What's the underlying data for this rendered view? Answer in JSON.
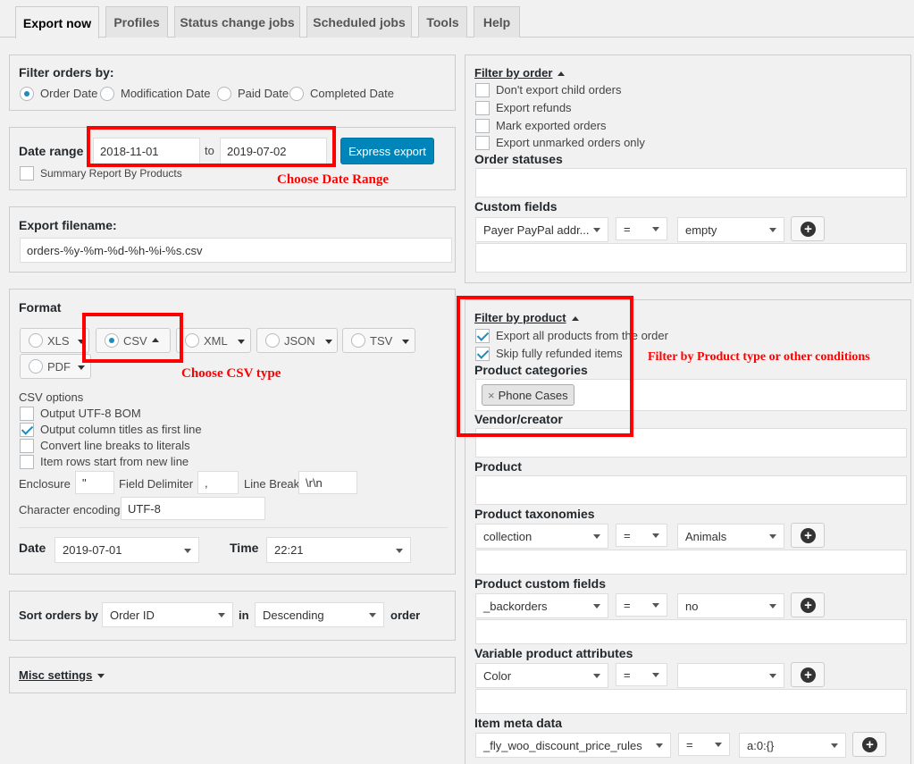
{
  "tabs": [
    "Export now",
    "Profiles",
    "Status change jobs",
    "Scheduled jobs",
    "Tools",
    "Help"
  ],
  "filter_orders": {
    "title": "Filter orders by:",
    "options": [
      "Order Date",
      "Modification Date",
      "Paid Date",
      "Completed Date"
    ],
    "selected": "Order Date"
  },
  "date_range": {
    "label": "Date range",
    "from": "2018-11-01",
    "to_label": "to",
    "to": "2019-07-02",
    "express_button": "Express export",
    "summary_label": "Summary Report By Products",
    "annotation": "Choose Date Range"
  },
  "export_filename": {
    "label": "Export filename:",
    "value": "orders-%y-%m-%d-%h-%i-%s.csv"
  },
  "format": {
    "title": "Format",
    "buttons": [
      "XLS",
      "CSV",
      "XML",
      "JSON",
      "TSV",
      "PDF"
    ],
    "selected": "CSV",
    "annotation": "Choose CSV type",
    "csv_options_title": "CSV options",
    "csv_options": [
      {
        "label": "Output UTF-8 BOM",
        "checked": false
      },
      {
        "label": "Output column titles as first line",
        "checked": true
      },
      {
        "label": "Convert line breaks to literals",
        "checked": false
      },
      {
        "label": "Item rows start from new line",
        "checked": false
      }
    ],
    "enclosure_label": "Enclosure",
    "enclosure_value": "\"",
    "field_delimiter_label": "Field Delimiter",
    "field_delimiter_value": ",",
    "line_break_label": "Line Break",
    "line_break_value": "\\r\\n",
    "encoding_label": "Character encoding",
    "encoding_value": "UTF-8",
    "date_label": "Date",
    "date_value": "2019-07-01",
    "time_label": "Time",
    "time_value": "22:21"
  },
  "sort": {
    "label": "Sort orders by",
    "field": "Order ID",
    "in_label": "in",
    "direction": "Descending",
    "order_label": "order"
  },
  "misc": {
    "label": "Misc settings"
  },
  "filter_by_order": {
    "title": "Filter by order",
    "checks": [
      {
        "label": "Don't export child orders",
        "checked": false
      },
      {
        "label": "Export refunds",
        "checked": false
      },
      {
        "label": "Mark exported orders",
        "checked": false
      },
      {
        "label": "Export unmarked orders only",
        "checked": false
      }
    ],
    "order_statuses": "Order statuses",
    "custom_fields": "Custom fields",
    "cf_field": "Payer PayPal addr...",
    "cf_op": "=",
    "cf_value": "empty"
  },
  "filter_by_product": {
    "title": "Filter by product",
    "checks": [
      {
        "label": "Export all products from the order",
        "checked": true
      },
      {
        "label": "Skip fully refunded items",
        "checked": true
      }
    ],
    "annotation": "Filter by Product type or other conditions",
    "product_categories": "Product categories",
    "category_tag": "Phone Cases",
    "vendor": "Vendor/creator",
    "product": "Product",
    "taxonomies": {
      "label": "Product taxonomies",
      "field": "collection",
      "op": "=",
      "value": "Animals"
    },
    "custom": {
      "label": "Product custom fields",
      "field": "_backorders",
      "op": "=",
      "value": "no"
    },
    "attributes": {
      "label": "Variable product attributes",
      "field": "Color",
      "op": "=",
      "value": ""
    },
    "item_meta": {
      "label": "Item meta data",
      "field": "_fly_woo_discount_price_rules",
      "op": "=",
      "value": "a:0:{}"
    }
  }
}
